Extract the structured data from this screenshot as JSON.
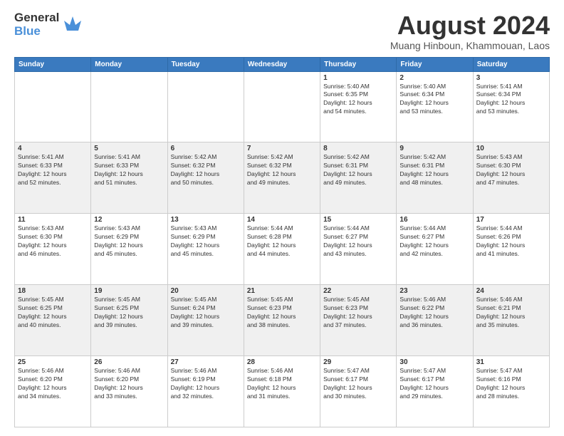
{
  "header": {
    "logo_line1": "General",
    "logo_line2": "Blue",
    "title": "August 2024",
    "location": "Muang Hinboun, Khammouan, Laos"
  },
  "days_of_week": [
    "Sunday",
    "Monday",
    "Tuesday",
    "Wednesday",
    "Thursday",
    "Friday",
    "Saturday"
  ],
  "weeks": [
    [
      {
        "day": "",
        "info": ""
      },
      {
        "day": "",
        "info": ""
      },
      {
        "day": "",
        "info": ""
      },
      {
        "day": "",
        "info": ""
      },
      {
        "day": "1",
        "info": "Sunrise: 5:40 AM\nSunset: 6:35 PM\nDaylight: 12 hours\nand 54 minutes."
      },
      {
        "day": "2",
        "info": "Sunrise: 5:40 AM\nSunset: 6:34 PM\nDaylight: 12 hours\nand 53 minutes."
      },
      {
        "day": "3",
        "info": "Sunrise: 5:41 AM\nSunset: 6:34 PM\nDaylight: 12 hours\nand 53 minutes."
      }
    ],
    [
      {
        "day": "4",
        "info": "Sunrise: 5:41 AM\nSunset: 6:33 PM\nDaylight: 12 hours\nand 52 minutes."
      },
      {
        "day": "5",
        "info": "Sunrise: 5:41 AM\nSunset: 6:33 PM\nDaylight: 12 hours\nand 51 minutes."
      },
      {
        "day": "6",
        "info": "Sunrise: 5:42 AM\nSunset: 6:32 PM\nDaylight: 12 hours\nand 50 minutes."
      },
      {
        "day": "7",
        "info": "Sunrise: 5:42 AM\nSunset: 6:32 PM\nDaylight: 12 hours\nand 49 minutes."
      },
      {
        "day": "8",
        "info": "Sunrise: 5:42 AM\nSunset: 6:31 PM\nDaylight: 12 hours\nand 49 minutes."
      },
      {
        "day": "9",
        "info": "Sunrise: 5:42 AM\nSunset: 6:31 PM\nDaylight: 12 hours\nand 48 minutes."
      },
      {
        "day": "10",
        "info": "Sunrise: 5:43 AM\nSunset: 6:30 PM\nDaylight: 12 hours\nand 47 minutes."
      }
    ],
    [
      {
        "day": "11",
        "info": "Sunrise: 5:43 AM\nSunset: 6:30 PM\nDaylight: 12 hours\nand 46 minutes."
      },
      {
        "day": "12",
        "info": "Sunrise: 5:43 AM\nSunset: 6:29 PM\nDaylight: 12 hours\nand 45 minutes."
      },
      {
        "day": "13",
        "info": "Sunrise: 5:43 AM\nSunset: 6:29 PM\nDaylight: 12 hours\nand 45 minutes."
      },
      {
        "day": "14",
        "info": "Sunrise: 5:44 AM\nSunset: 6:28 PM\nDaylight: 12 hours\nand 44 minutes."
      },
      {
        "day": "15",
        "info": "Sunrise: 5:44 AM\nSunset: 6:27 PM\nDaylight: 12 hours\nand 43 minutes."
      },
      {
        "day": "16",
        "info": "Sunrise: 5:44 AM\nSunset: 6:27 PM\nDaylight: 12 hours\nand 42 minutes."
      },
      {
        "day": "17",
        "info": "Sunrise: 5:44 AM\nSunset: 6:26 PM\nDaylight: 12 hours\nand 41 minutes."
      }
    ],
    [
      {
        "day": "18",
        "info": "Sunrise: 5:45 AM\nSunset: 6:25 PM\nDaylight: 12 hours\nand 40 minutes."
      },
      {
        "day": "19",
        "info": "Sunrise: 5:45 AM\nSunset: 6:25 PM\nDaylight: 12 hours\nand 39 minutes."
      },
      {
        "day": "20",
        "info": "Sunrise: 5:45 AM\nSunset: 6:24 PM\nDaylight: 12 hours\nand 39 minutes."
      },
      {
        "day": "21",
        "info": "Sunrise: 5:45 AM\nSunset: 6:23 PM\nDaylight: 12 hours\nand 38 minutes."
      },
      {
        "day": "22",
        "info": "Sunrise: 5:45 AM\nSunset: 6:23 PM\nDaylight: 12 hours\nand 37 minutes."
      },
      {
        "day": "23",
        "info": "Sunrise: 5:46 AM\nSunset: 6:22 PM\nDaylight: 12 hours\nand 36 minutes."
      },
      {
        "day": "24",
        "info": "Sunrise: 5:46 AM\nSunset: 6:21 PM\nDaylight: 12 hours\nand 35 minutes."
      }
    ],
    [
      {
        "day": "25",
        "info": "Sunrise: 5:46 AM\nSunset: 6:20 PM\nDaylight: 12 hours\nand 34 minutes."
      },
      {
        "day": "26",
        "info": "Sunrise: 5:46 AM\nSunset: 6:20 PM\nDaylight: 12 hours\nand 33 minutes."
      },
      {
        "day": "27",
        "info": "Sunrise: 5:46 AM\nSunset: 6:19 PM\nDaylight: 12 hours\nand 32 minutes."
      },
      {
        "day": "28",
        "info": "Sunrise: 5:46 AM\nSunset: 6:18 PM\nDaylight: 12 hours\nand 31 minutes."
      },
      {
        "day": "29",
        "info": "Sunrise: 5:47 AM\nSunset: 6:17 PM\nDaylight: 12 hours\nand 30 minutes."
      },
      {
        "day": "30",
        "info": "Sunrise: 5:47 AM\nSunset: 6:17 PM\nDaylight: 12 hours\nand 29 minutes."
      },
      {
        "day": "31",
        "info": "Sunrise: 5:47 AM\nSunset: 6:16 PM\nDaylight: 12 hours\nand 28 minutes."
      }
    ]
  ]
}
